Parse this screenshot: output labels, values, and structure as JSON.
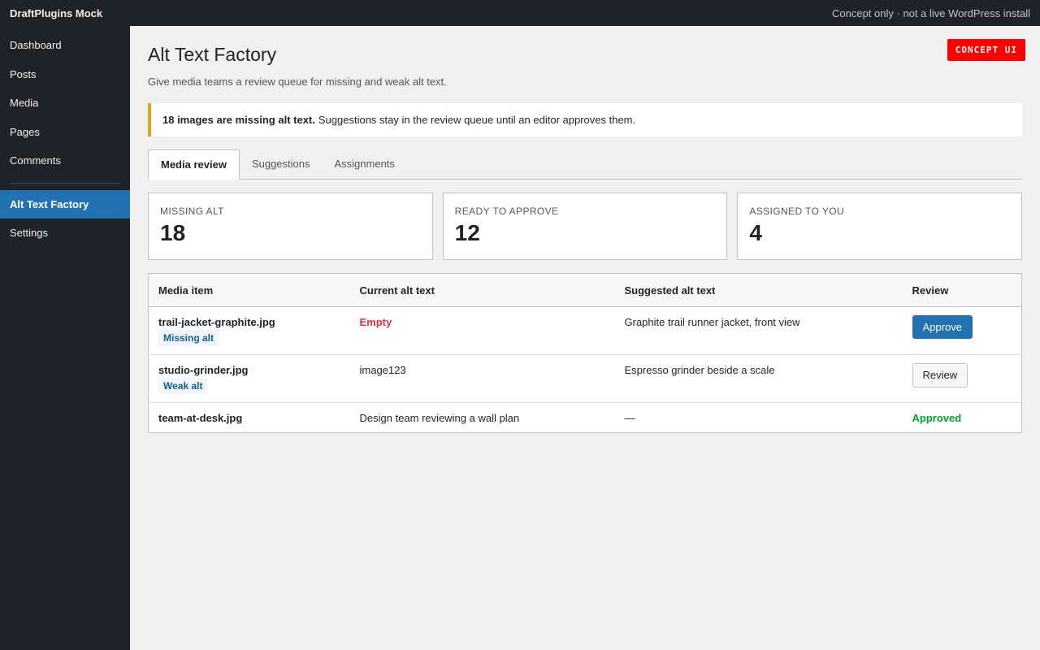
{
  "topbar": {
    "brand": "DraftPlugins Mock",
    "note": "Concept only · not a live WordPress install"
  },
  "sidebar": {
    "items": [
      {
        "label": "Dashboard"
      },
      {
        "label": "Posts"
      },
      {
        "label": "Media"
      },
      {
        "label": "Pages"
      },
      {
        "label": "Comments"
      },
      {
        "label": "Alt Text Factory",
        "active": true
      },
      {
        "label": "Settings"
      }
    ]
  },
  "page": {
    "badge": "CONCEPT UI",
    "title": "Alt Text Factory",
    "description": "Give media teams a review queue for missing and weak alt text."
  },
  "notice": {
    "strong": "18 images are missing alt text.",
    "text": "Suggestions stay in the review queue until an editor approves them."
  },
  "tabs": [
    {
      "label": "Media review",
      "active": true
    },
    {
      "label": "Suggestions"
    },
    {
      "label": "Assignments"
    }
  ],
  "stats": [
    {
      "label": "Missing alt",
      "value": "18"
    },
    {
      "label": "Ready to approve",
      "value": "12"
    },
    {
      "label": "Assigned to you",
      "value": "4"
    }
  ],
  "table": {
    "headers": [
      "Media item",
      "Current alt text",
      "Suggested alt text",
      "Review"
    ],
    "rows": [
      {
        "file": "trail-jacket-graphite.jpg",
        "tag": "Missing alt",
        "current": "Empty",
        "suggested": "Graphite trail runner jacket, front view",
        "action": "Approve"
      },
      {
        "file": "studio-grinder.jpg",
        "tag": "Weak alt",
        "current": "image123",
        "suggested": "Espresso grinder beside a scale",
        "action": "Review"
      },
      {
        "file": "team-at-desk.jpg",
        "tag": "",
        "current": "Design team reviewing a wall plan",
        "suggested": "—",
        "action": "Approved"
      }
    ]
  },
  "colors": {
    "accent": "#2271b1",
    "notice_border": "#dba617",
    "danger": "#d63638",
    "success": "#00a32a",
    "admin_bar": "#1d2327"
  }
}
